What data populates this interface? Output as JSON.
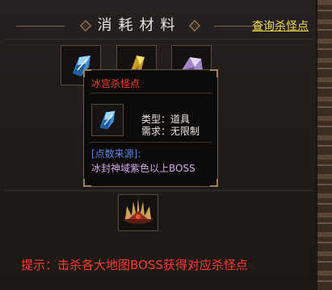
{
  "header": {
    "title": "消耗材料",
    "query_link": "查询杀怪点"
  },
  "materials": [
    {
      "icon": "blue-crystal-icon"
    },
    {
      "icon": "gold-crystal-icon"
    },
    {
      "icon": "purple-crystal-icon"
    }
  ],
  "tooltip": {
    "name": "冰宫杀怪点",
    "type_label": "类型：",
    "type_value": "道具",
    "req_label": "需求：",
    "req_value": "无限制",
    "source_label": "[点数来源]:",
    "source_text": "冰封神域紫色以上BOSS"
  },
  "reward": {
    "icon": "spiked-crown-icon"
  },
  "hint": "提示：击杀各大地图BOSS获得对应杀怪点",
  "colors": {
    "link": "#f2e04a",
    "hint": "#ff3b30",
    "tooltip_title": "#ff3b30",
    "source_label": "#5a88e6",
    "source_text": "#d8a6f2"
  }
}
